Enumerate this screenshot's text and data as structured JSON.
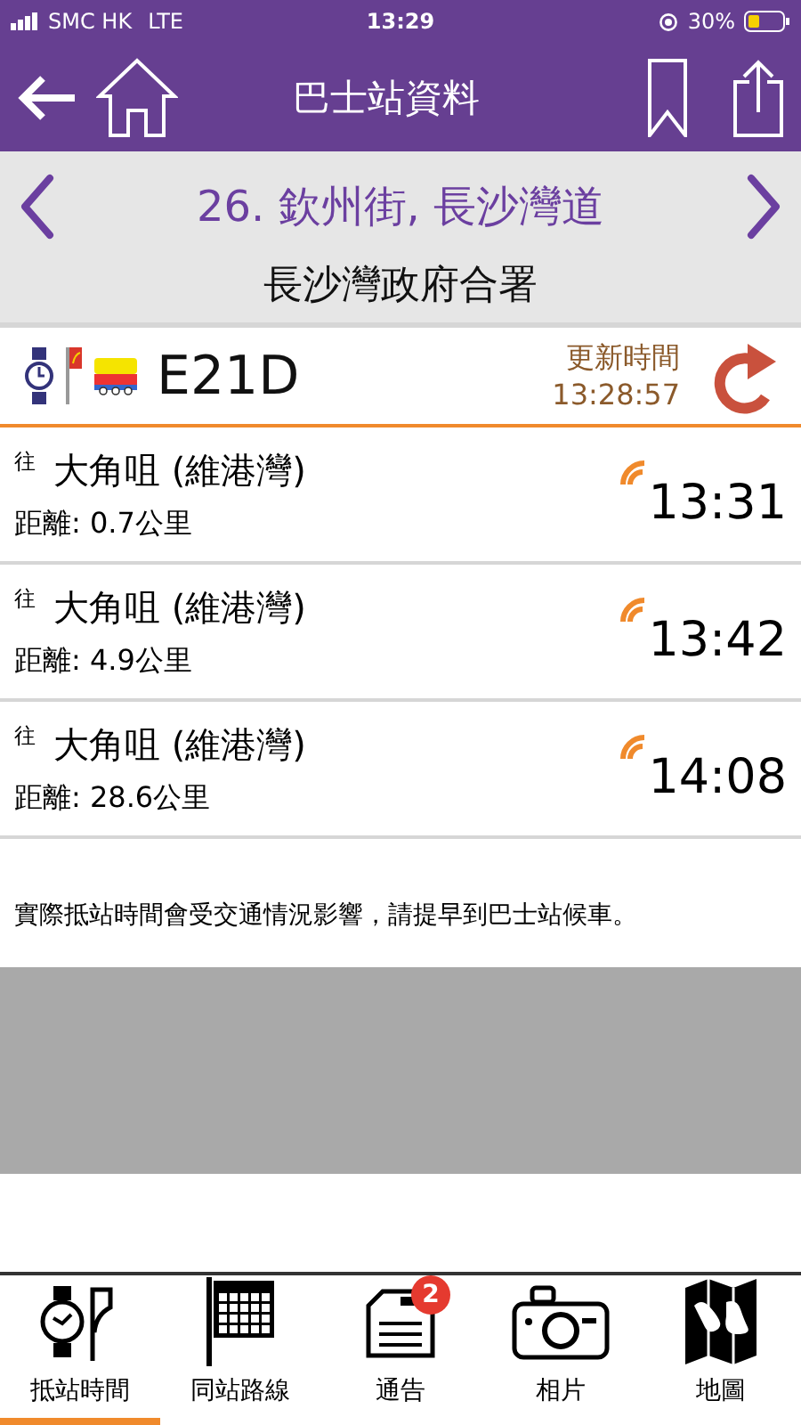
{
  "status_bar": {
    "carrier": "SMC HK",
    "network": "LTE",
    "time": "13:29",
    "battery": "30%"
  },
  "nav_bar": {
    "title": "巴士站資料"
  },
  "stop": {
    "name": "26. 欽州街, 長沙灣道",
    "landmark": "長沙灣政府合署"
  },
  "route": {
    "number": "E21D",
    "update_label": "更新時間",
    "update_time": "13:28:57"
  },
  "arrivals": [
    {
      "prefix": "往",
      "destination": "大角咀 (維港灣)",
      "distance": "距離: 0.7公里",
      "time": "13:31",
      "live": true
    },
    {
      "prefix": "往",
      "destination": "大角咀 (維港灣)",
      "distance": "距離: 4.9公里",
      "time": "13:42",
      "live": true
    },
    {
      "prefix": "往",
      "destination": "大角咀 (維港灣)",
      "distance": "距離: 28.6公里",
      "time": "14:08",
      "live": true
    }
  ],
  "notice": "實際抵站時間會受交通情況影響，請提早到巴士站候車。",
  "tabs": [
    {
      "kind": "watch",
      "label": "抵站時間",
      "selected": true
    },
    {
      "kind": "table",
      "label": "同站路線",
      "selected": false
    },
    {
      "kind": "notice",
      "label": "通告",
      "selected": false,
      "badge": "2"
    },
    {
      "kind": "camera",
      "label": "相片",
      "selected": false
    },
    {
      "kind": "map",
      "label": "地圖",
      "selected": false
    }
  ]
}
